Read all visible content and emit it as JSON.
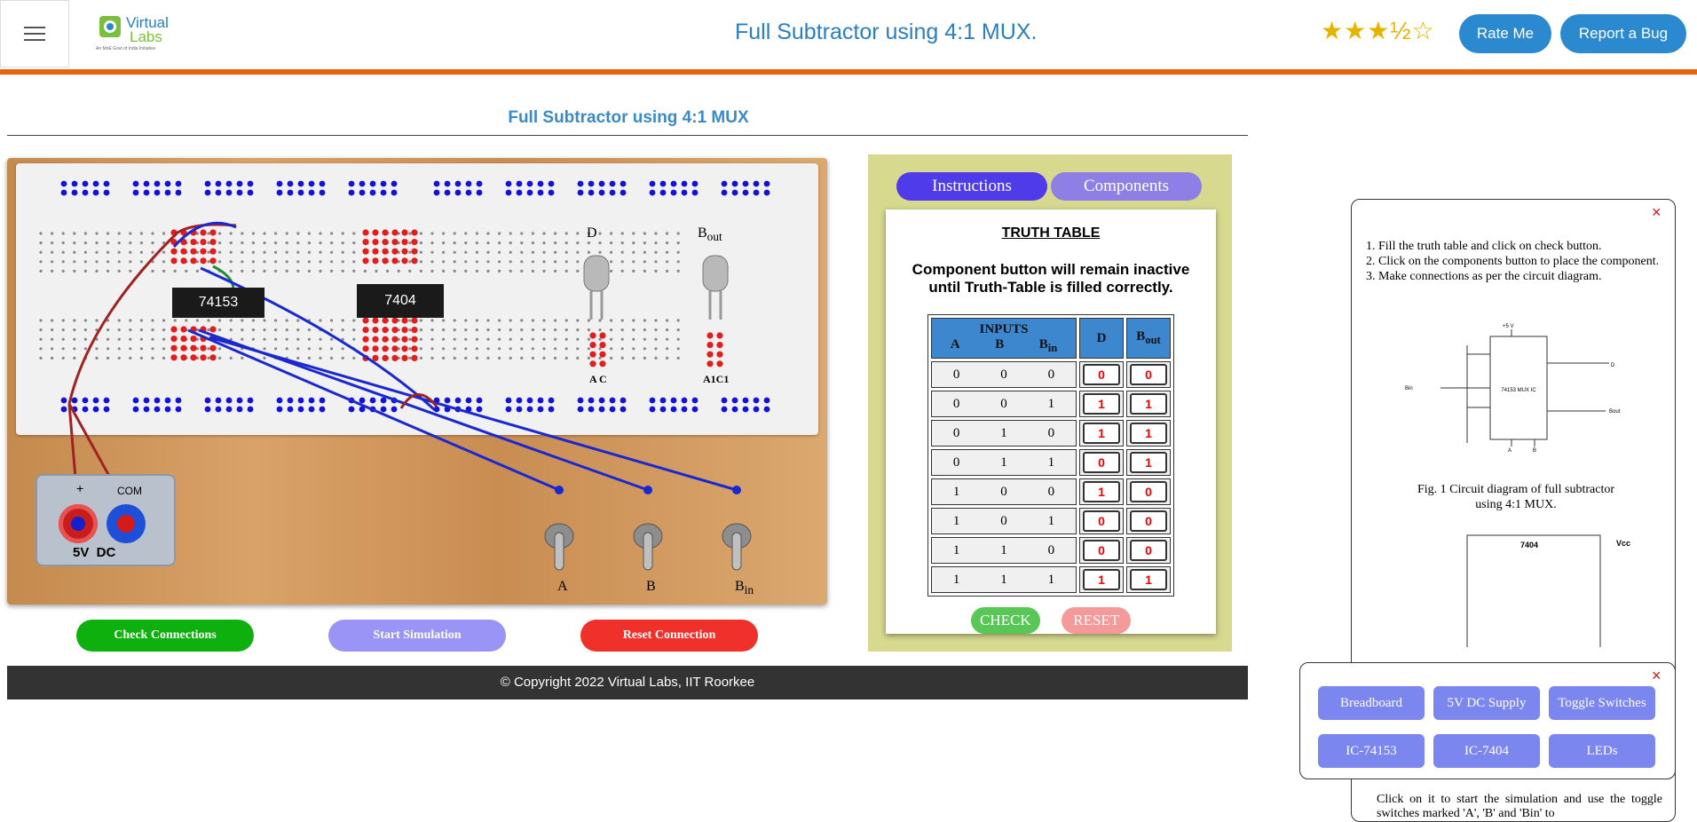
{
  "header": {
    "app_title": "Full Subtractor using 4:1 MUX.",
    "rating_stars": "★★★½☆",
    "rate_label": "Rate Me",
    "bug_label": "Report a Bug",
    "logo_text": "Virtual",
    "logo_text2": "Labs",
    "logo_tagline": "An MoE Govt of India Initiative"
  },
  "colors": {
    "accent": "#e8650e",
    "brand_blue": "#2a89cf",
    "panel_bg": "#d6d98e",
    "check_green": "#0db00d",
    "sim_purple": "#9b94f7",
    "reset_red": "#f0302a"
  },
  "experiment": {
    "title": "Full Subtractor using 4:1 MUX",
    "ic1_label": "74153",
    "ic2_label": "7404",
    "led1_label": "D",
    "led2_label": "B",
    "led2_sub": "out",
    "led1_pins": "A C",
    "led2_pins": "A1C1",
    "power_pos": "+",
    "power_com": "COM",
    "power_label": "5V  DC",
    "switch_a": "A",
    "switch_b": "B",
    "switch_c": "B",
    "switch_c_sub": "in"
  },
  "actions": {
    "check_connections": "Check Connections",
    "start_simulation": "Start Simulation",
    "reset_connection": "Reset Connection"
  },
  "side": {
    "tab_instructions": "Instructions",
    "tab_components": "Components",
    "tt_title": "TRUTH TABLE",
    "tt_note": "Component button will remain inactive until Truth-Table is filled correctly.",
    "inputs_header": "INPUTS",
    "col_a": "A",
    "col_b": "B",
    "col_bin": "B",
    "col_bin_sub": "in",
    "col_d": "D",
    "col_bout": "B",
    "col_bout_sub": "out",
    "check_label": "CHECK",
    "reset_label": "RESET",
    "rows": [
      {
        "a": "0",
        "b": "0",
        "c": "0",
        "d": "0",
        "bo": "0"
      },
      {
        "a": "0",
        "b": "0",
        "c": "1",
        "d": "1",
        "bo": "1"
      },
      {
        "a": "0",
        "b": "1",
        "c": "0",
        "d": "1",
        "bo": "1"
      },
      {
        "a": "0",
        "b": "1",
        "c": "1",
        "d": "0",
        "bo": "1"
      },
      {
        "a": "1",
        "b": "0",
        "c": "0",
        "d": "1",
        "bo": "0"
      },
      {
        "a": "1",
        "b": "0",
        "c": "1",
        "d": "0",
        "bo": "0"
      },
      {
        "a": "1",
        "b": "1",
        "c": "0",
        "d": "0",
        "bo": "0"
      },
      {
        "a": "1",
        "b": "1",
        "c": "1",
        "d": "1",
        "bo": "1"
      }
    ]
  },
  "instructions": {
    "close": "×",
    "steps": [
      "Fill the truth table and click on check button.",
      "Click on the components button to place the component.",
      "Make connections as per the circuit diagram."
    ],
    "fig1_caption": "Fig. 1 Circuit diagram of full subtractor using 4:1 MUX.",
    "fig1_chip_label": "74153 MUX IC",
    "fig1_vcc": "+5 V",
    "fig1_d": "D",
    "fig1_bout": "Bout",
    "fig1_bin": "Bin",
    "fig1_a": "A",
    "fig1_b": "B",
    "fig2_chip": "7404",
    "fig2_vcc": "Vcc",
    "trailing_text": "Click on it to start the simulation and use the toggle switches marked 'A', 'B' and 'Bin' to"
  },
  "components": {
    "close": "×",
    "items": [
      "Breadboard",
      "5V DC Supply",
      "Toggle Switches",
      "IC-74153",
      "IC-7404",
      "LEDs"
    ]
  },
  "footer": {
    "text": "© Copyright 2022 Virtual Labs, IIT Roorkee"
  }
}
